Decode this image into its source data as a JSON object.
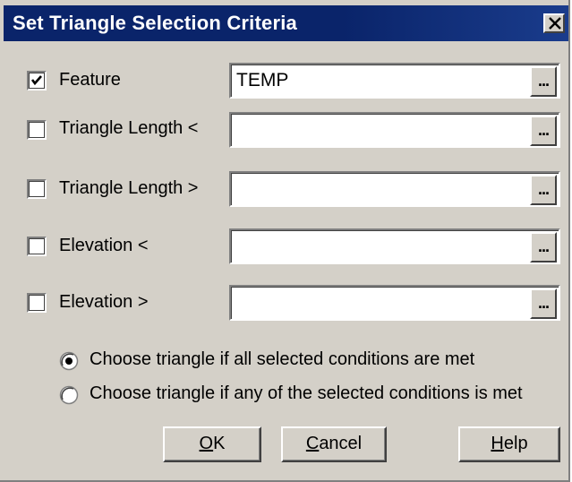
{
  "window": {
    "title": "Set Triangle Selection Criteria",
    "close_glyph": "×"
  },
  "criteria": [
    {
      "label": "Feature",
      "checked": true,
      "value": "TEMP",
      "browse": "..."
    },
    {
      "label": "Triangle Length <",
      "checked": false,
      "value": "",
      "browse": "..."
    },
    {
      "label": "Triangle Length >",
      "checked": false,
      "value": "",
      "browse": "..."
    },
    {
      "label": "Elevation <",
      "checked": false,
      "value": "",
      "browse": "..."
    },
    {
      "label": "Elevation >",
      "checked": false,
      "value": "",
      "browse": "..."
    }
  ],
  "options": [
    {
      "label": "Choose triangle if all selected conditions are met",
      "selected": true
    },
    {
      "label": "Choose triangle if any of the selected conditions is met",
      "selected": false
    }
  ],
  "buttons": {
    "ok": {
      "mnemonic": "O",
      "rest": "K"
    },
    "cancel": {
      "mnemonic": "C",
      "rest": "ancel"
    },
    "help": {
      "mnemonic": "H",
      "rest": "elp"
    }
  },
  "colors": {
    "title_bar": "#0a246a",
    "dialog_bg": "#d4d0c8"
  },
  "icons": {
    "close": "close-icon",
    "check": "checkmark-icon",
    "radio": "radio-dot-icon"
  }
}
